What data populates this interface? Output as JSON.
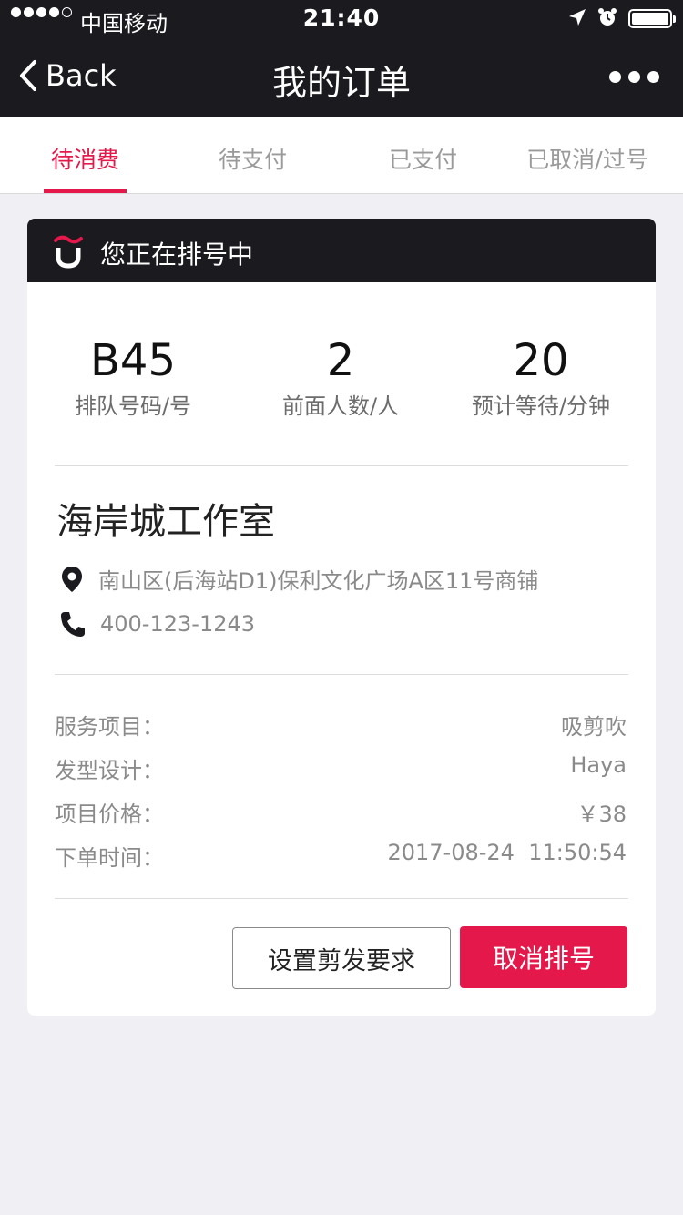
{
  "status_bar": {
    "carrier": "中国移动",
    "time": "21:40"
  },
  "nav": {
    "back_label": "Back",
    "title": "我的订单"
  },
  "tabs": [
    {
      "label": "待消费",
      "active": true
    },
    {
      "label": "待支付",
      "active": false
    },
    {
      "label": "已支付",
      "active": false
    },
    {
      "label": "已取消/过号",
      "active": false
    }
  ],
  "card": {
    "header_text": "您正在排号中",
    "stats": [
      {
        "value": "B45",
        "label": "排队号码/号"
      },
      {
        "value": "2",
        "label": "前面人数/人"
      },
      {
        "value": "20",
        "label": "预计等待/分钟"
      }
    ],
    "shop_name": "海岸城工作室",
    "address": "南山区(后海站D1)保利文化广场A区11号商铺",
    "phone": "400-123-1243",
    "details": [
      {
        "key": "服务项目：",
        "value": "吸剪吹"
      },
      {
        "key": "发型设计：",
        "value": "Haya"
      },
      {
        "key": "项目价格：",
        "value": "￥38"
      },
      {
        "key": "下单时间：",
        "value": "2017-08-24  11:50:54"
      }
    ],
    "buttons": {
      "secondary": "设置剪发要求",
      "primary": "取消排号"
    }
  },
  "colors": {
    "accent": "#e4184a",
    "header_bg": "#1a1a1f",
    "page_bg": "#efeff4"
  }
}
